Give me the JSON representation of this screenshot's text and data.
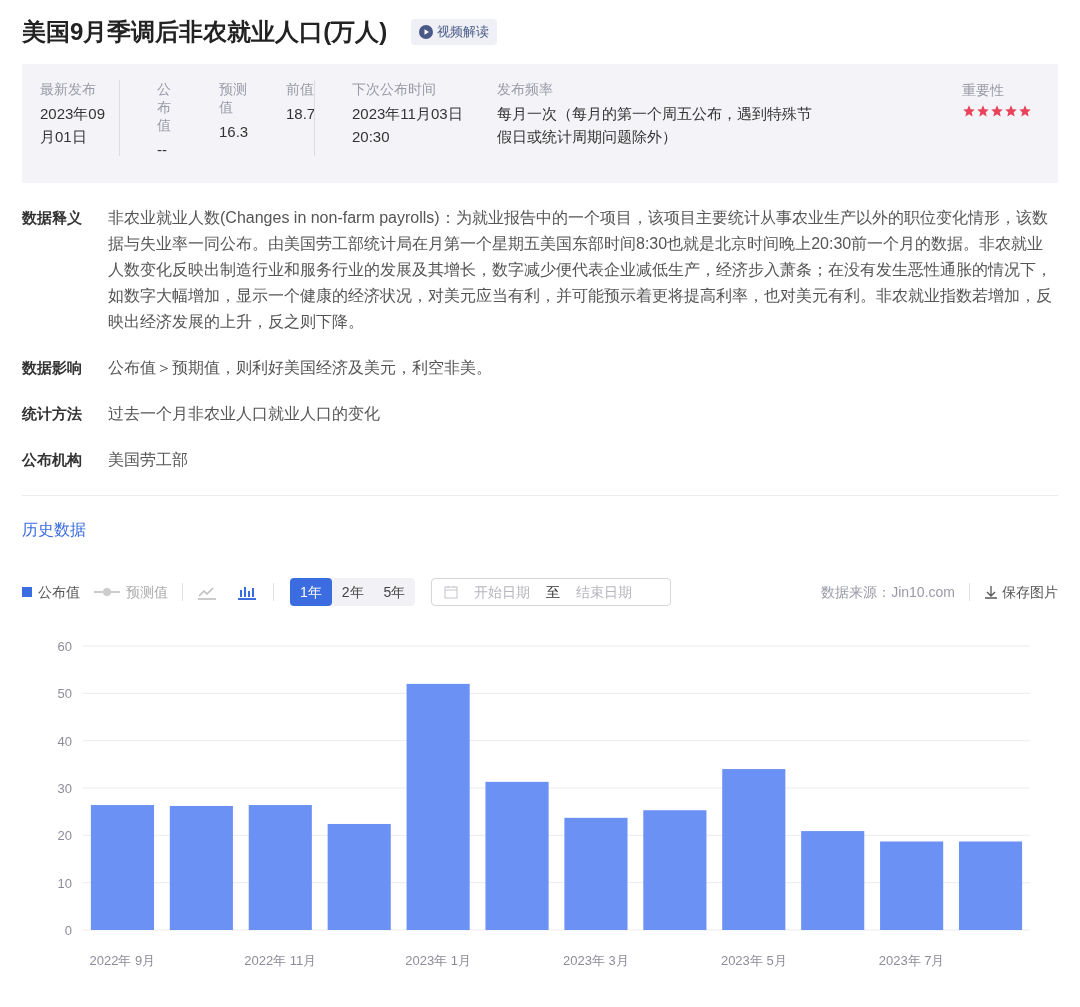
{
  "title": "美国9月季调后非农就业人口(万人)",
  "video_button": "视频解读",
  "info": {
    "columns": [
      {
        "label": "最新发布",
        "value": "2023年09月01日"
      },
      {
        "label": "公布值",
        "value": "--"
      },
      {
        "label": "预测值",
        "value": "16.3"
      },
      {
        "label": "前值",
        "value": "18.7"
      },
      {
        "label": "下次公布时间",
        "value": "2023年11月03日 20:30"
      },
      {
        "label": "发布频率",
        "value": "每月一次（每月的第一个周五公布，遇到特殊节假日或统计周期问题除外）"
      }
    ],
    "importance": {
      "label": "重要性",
      "stars": 5
    }
  },
  "details": [
    {
      "label": "数据释义",
      "text": "非农业就业人数(Changes in non-farm payrolls)：为就业报告中的一个项目，该项目主要统计从事农业生产以外的职位变化情形，该数据与失业率一同公布。由美国劳工部统计局在月第一个星期五美国东部时间8:30也就是北京时间晚上20:30前一个月的数据。非农就业人数变化反映出制造行业和服务行业的发展及其增长，数字减少便代表企业减低生产，经济步入萧条；在没有发生恶性通胀的情况下，如数字大幅增加，显示一个健康的经济状况，对美元应当有利，并可能预示着更将提高利率，也对美元有利。非农就业指数若增加，反映出经济发展的上升，反之则下降。"
    },
    {
      "label": "数据影响",
      "text": "公布值＞预期值，则利好美国经济及美元，利空非美。"
    },
    {
      "label": "统计方法",
      "text": "过去一个月非农业人口就业人口的变化"
    },
    {
      "label": "公布机构",
      "text": "美国劳工部"
    }
  ],
  "history": {
    "title": "历史数据",
    "legend": [
      {
        "kind": "bar",
        "on": true
      },
      {
        "kind": "line",
        "label": "预测值",
        "on": false
      }
    ],
    "chart_types": [
      {
        "kind": "line",
        "selected": false
      },
      {
        "kind": "bar",
        "selected": true
      }
    ],
    "ranges": [
      {
        "label": "1年",
        "selected": true
      },
      {
        "label": "2年",
        "selected": false
      },
      {
        "label": "5年",
        "selected": false
      }
    ],
    "date_range": {
      "start_placeholder": "开始日期",
      "separator": "至",
      "end_placeholder": "结束日期"
    },
    "source": "数据来源：Jin10.com",
    "save": "保存图片",
    "chart_data": {
      "type": "bar",
      "ylim": [
        0,
        60
      ],
      "yticks": [
        0,
        10,
        20,
        30,
        40,
        50,
        60
      ],
      "grid": true,
      "categories": [
        "2022年 9月",
        null,
        "2022年 11月",
        null,
        "2023年 1月",
        null,
        "2023年 3月",
        null,
        "2023年 5月",
        null,
        "2023年 7月",
        null
      ],
      "series": [
        {
          "name": "公布值",
          "color": "#6b91f5",
          "values": [
            26.4,
            26.2,
            26.4,
            22.4,
            52.0,
            31.3,
            23.7,
            25.3,
            34.0,
            20.9,
            18.7,
            18.7
          ]
        }
      ]
    }
  }
}
